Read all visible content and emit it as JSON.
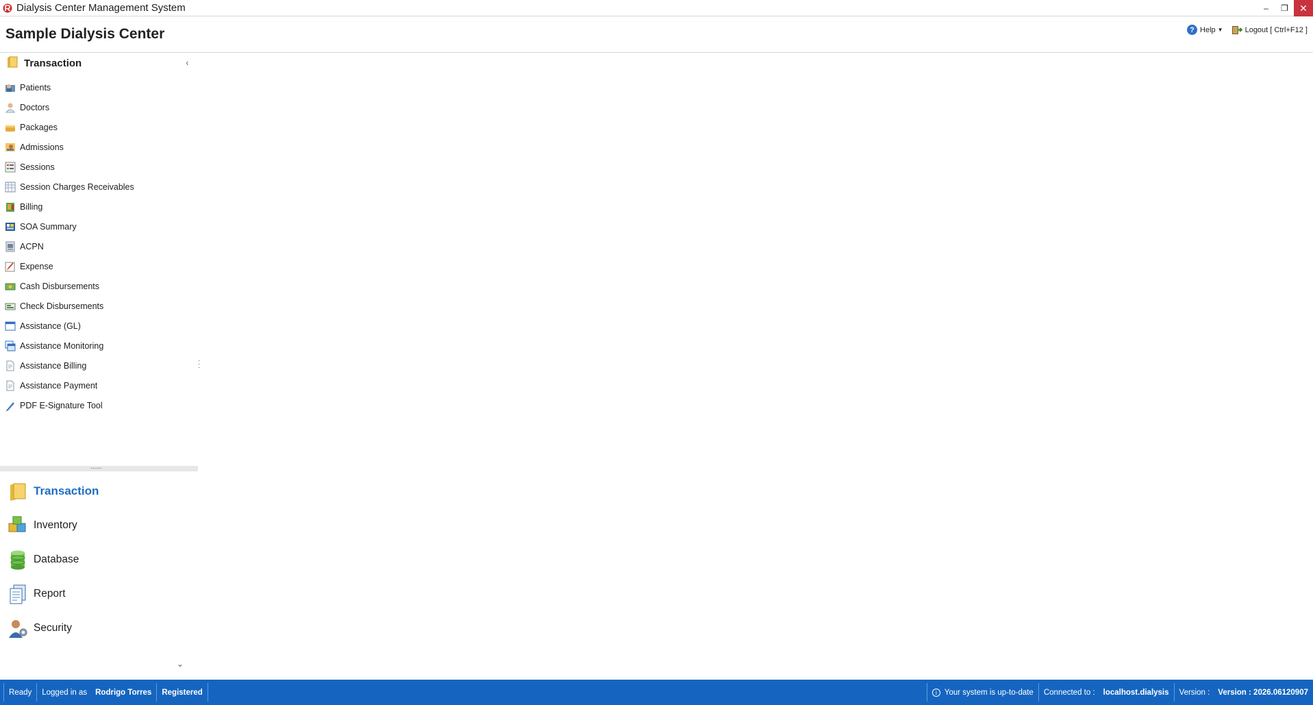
{
  "window": {
    "title": "Dialysis Center Management System",
    "icon": "app-logo-icon",
    "controls": {
      "minimize": "–",
      "restore": "❐",
      "close": "✕"
    }
  },
  "header": {
    "center_name": "Sample Dialysis Center",
    "help_label": "Help",
    "help_icon": "?",
    "logout_label": "Logout [ Ctrl+F12 ]"
  },
  "sidebar": {
    "group_title": "Transaction",
    "collapse_glyph": "‹",
    "items": [
      {
        "label": "Patients",
        "icon": "patients-icon"
      },
      {
        "label": "Doctors",
        "icon": "doctor-icon"
      },
      {
        "label": "Packages",
        "icon": "packages-icon"
      },
      {
        "label": "Admissions",
        "icon": "admissions-icon"
      },
      {
        "label": "Sessions",
        "icon": "sessions-icon"
      },
      {
        "label": "Session Charges Receivables",
        "icon": "receivables-icon"
      },
      {
        "label": "Billing",
        "icon": "billing-icon"
      },
      {
        "label": "SOA Summary",
        "icon": "soa-summary-icon"
      },
      {
        "label": "ACPN",
        "icon": "acpn-icon"
      },
      {
        "label": "Expense",
        "icon": "expense-icon"
      },
      {
        "label": "Cash Disbursements",
        "icon": "cash-icon"
      },
      {
        "label": "Check Disbursements",
        "icon": "check-icon"
      },
      {
        "label": "Assistance (GL)",
        "icon": "window-icon"
      },
      {
        "label": "Assistance Monitoring",
        "icon": "monitoring-icon"
      },
      {
        "label": "Assistance Billing",
        "icon": "document-icon"
      },
      {
        "label": "Assistance Payment",
        "icon": "document-icon"
      },
      {
        "label": "PDF E-Signature Tool",
        "icon": "pen-icon"
      }
    ],
    "groups": [
      {
        "label": "Transaction",
        "icon": "folder-icon",
        "active": true
      },
      {
        "label": "Inventory",
        "icon": "inventory-icon",
        "active": false
      },
      {
        "label": "Database",
        "icon": "database-icon",
        "active": false
      },
      {
        "label": "Report",
        "icon": "report-icon",
        "active": false
      },
      {
        "label": "Security",
        "icon": "security-icon",
        "active": false
      }
    ],
    "splitter_glyph": "......",
    "scroll_glyph": "⌄"
  },
  "statusbar": {
    "ready": "Ready",
    "logged_in_label": "Logged in as",
    "user": "Rodrigo Torres",
    "registration": "Registered",
    "update_status": "Your system is up-to-date",
    "connected_label": "Connected to :",
    "connection": "localhost.dialysis",
    "version_label": "Version :",
    "version": "Version : 2026.06120907"
  },
  "colors": {
    "accent": "#1f6fc2",
    "statusbar": "#1565c0",
    "close_button": "#c9333e"
  }
}
